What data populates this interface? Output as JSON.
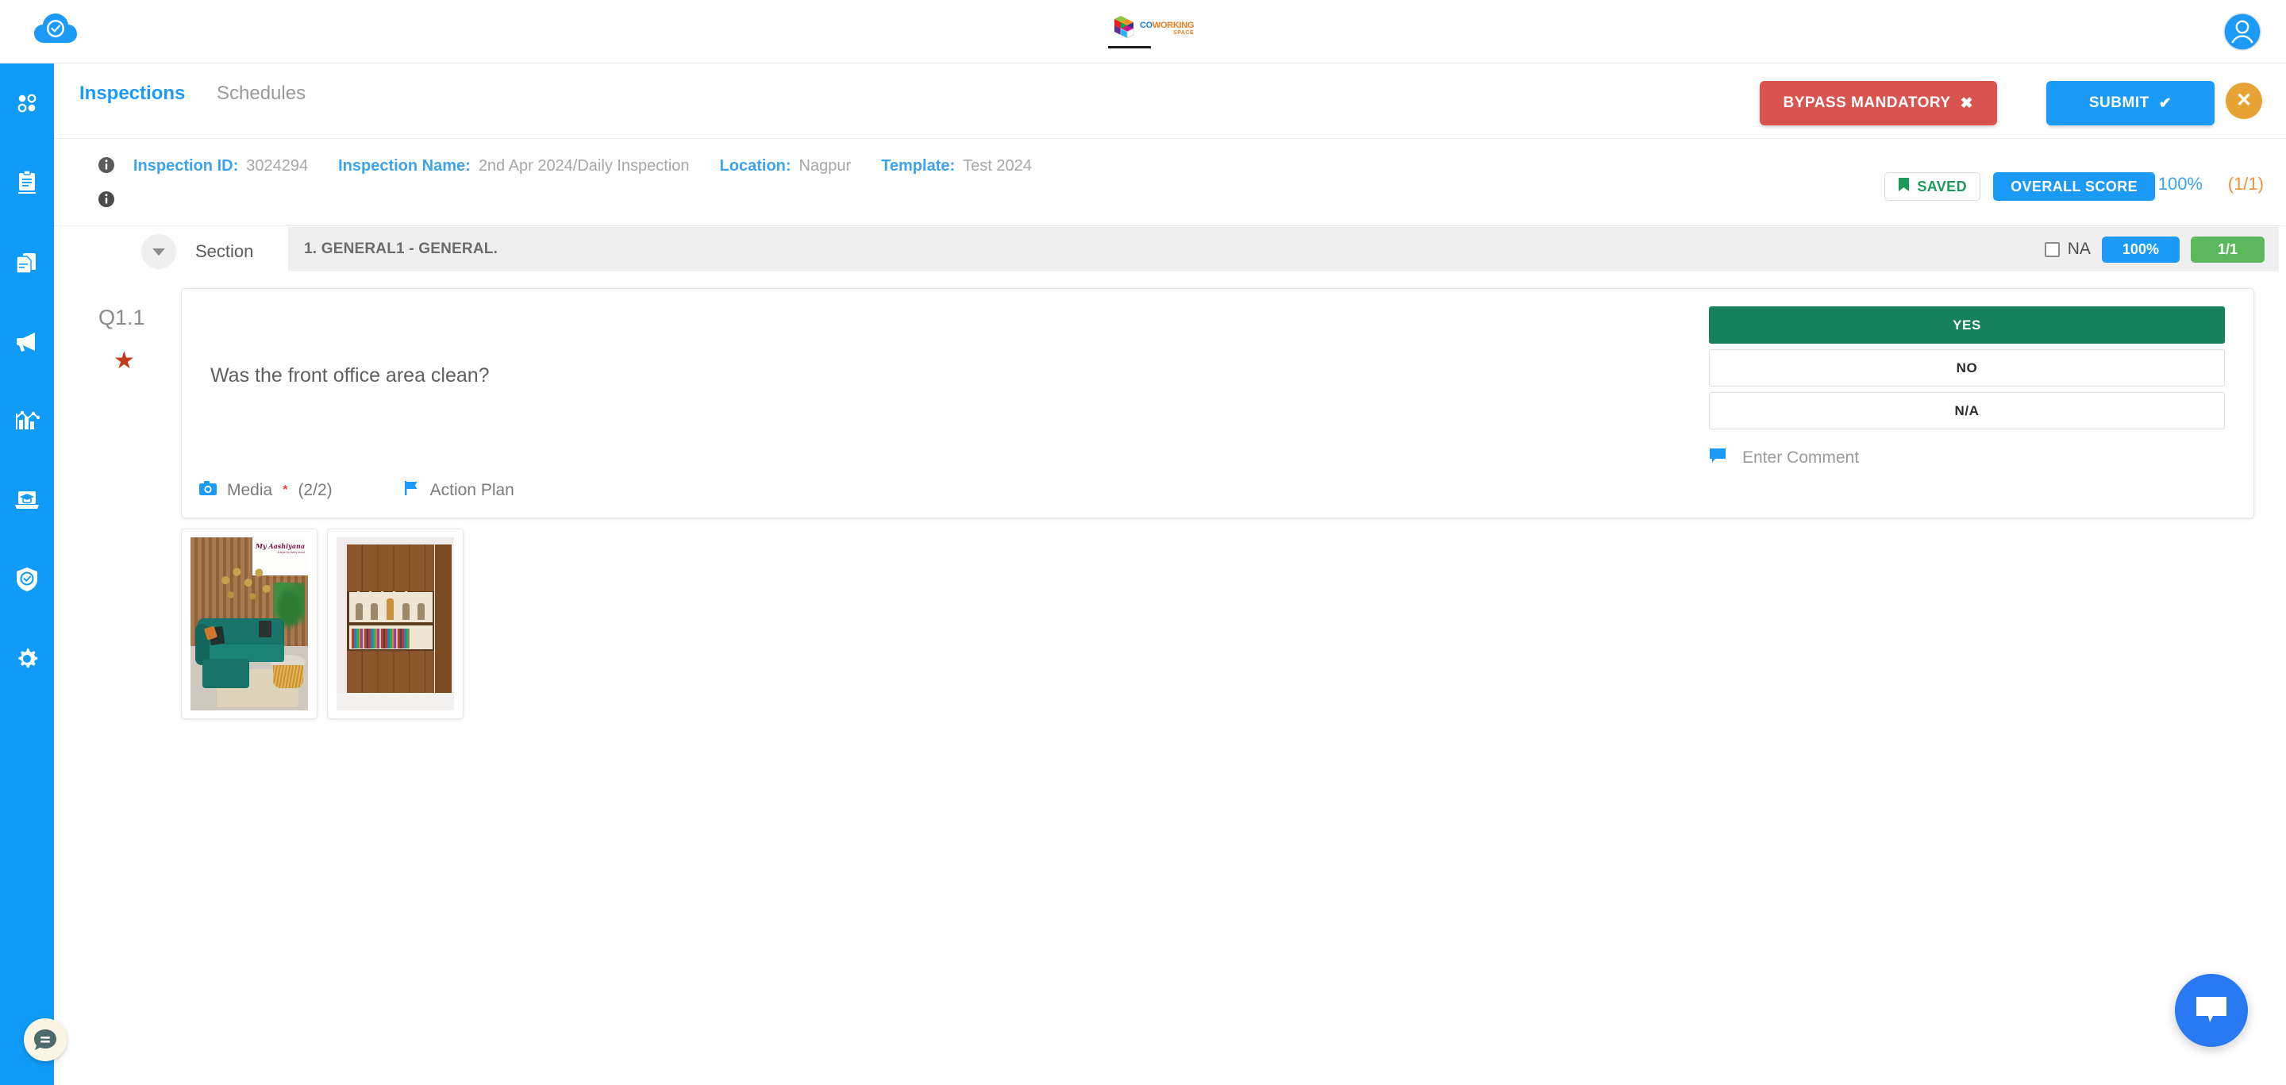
{
  "app": {
    "logo_icon": "cloud-check-icon",
    "brand": {
      "word1": "CO",
      "word2": "WORKING",
      "word3": "SPACE"
    },
    "avatar_icon": "user-avatar-icon"
  },
  "sidebar": {
    "items": [
      {
        "icon": "dashboard-dots-icon",
        "name": "dashboard"
      },
      {
        "icon": "clipboard-icon",
        "name": "inspections"
      },
      {
        "icon": "documents-icon",
        "name": "reports"
      },
      {
        "icon": "megaphone-icon",
        "name": "announcements"
      },
      {
        "icon": "analytics-chart-icon",
        "name": "analytics"
      },
      {
        "icon": "elearning-laptop-icon",
        "name": "elearning"
      },
      {
        "icon": "shield-check-icon",
        "name": "compliance"
      },
      {
        "icon": "gear-icon",
        "name": "settings"
      }
    ]
  },
  "tabs": [
    {
      "label": "Inspections",
      "active": true
    },
    {
      "label": "Schedules",
      "active": false
    }
  ],
  "actions": {
    "bypass_label": "BYPASS MANDATORY",
    "bypass_icon": "cross-icon",
    "submit_label": "SUBMIT",
    "submit_icon": "check-icon",
    "close_label": "✕"
  },
  "info": {
    "fields": [
      {
        "label": "Inspection ID:",
        "value": "3024294"
      },
      {
        "label": "Inspection Name:",
        "value": "2nd Apr 2024/Daily Inspection"
      },
      {
        "label": "Location:",
        "value": "Nagpur"
      },
      {
        "label": "Template:",
        "value": "Test 2024"
      }
    ],
    "saved_label": "SAVED",
    "saved_icon": "bookmark-flag-icon",
    "overall_score_label": "OVERALL SCORE",
    "score_percent": "100%",
    "score_fraction": "(1/1)"
  },
  "section": {
    "toggle_icon": "chevron-down-icon",
    "label": "Section",
    "title": "1. GENERAL1 - GENERAL.",
    "na_label": "NA",
    "na_checked": false,
    "percent_badge": "100%",
    "count_badge": "1/1"
  },
  "question": {
    "number": "Q1.1",
    "mandatory_icon": "star-icon",
    "text": "Was the front office area clean?",
    "answers": [
      {
        "label": "YES",
        "selected": true
      },
      {
        "label": "NO",
        "selected": false
      },
      {
        "label": "N/A",
        "selected": false
      }
    ],
    "comment_placeholder": "Enter Comment",
    "comment_icon": "comment-bubble-icon",
    "media_label": "Media",
    "media_required": "*",
    "media_count": "(2/2)",
    "media_icon": "camera-icon",
    "action_plan_label": "Action Plan",
    "action_plan_icon": "flag-icon"
  },
  "media_thumbnails": [
    {
      "name": "living-room-teal-sofa",
      "caption": "My Aashiyana",
      "subcaption": "A style for every mood"
    },
    {
      "name": "wooden-bookshelf-cabinet",
      "caption": "",
      "subcaption": ""
    }
  ],
  "floating": {
    "left_chat_icon": "chat-bubble-icon",
    "right_chat_icon": "messenger-bubble-icon"
  },
  "colors": {
    "brand_blue": "#1b9af7",
    "sidebar_blue": "#0f9bf7",
    "danger_red": "#d9534f",
    "success_green": "#17805c",
    "badge_green": "#5cb85c",
    "orange": "#e8a335",
    "saved_green": "#1d9a59"
  }
}
